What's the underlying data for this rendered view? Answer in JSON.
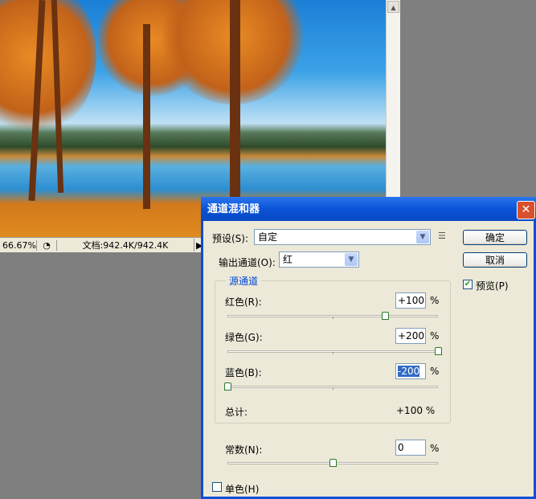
{
  "document": {
    "zoom": "66.67%",
    "doc_info": "文档:942.4K/942.4K"
  },
  "dialog": {
    "title": "通道混和器",
    "preset_label": "预设(S):",
    "preset_value": "自定",
    "output_label": "输出通道(O):",
    "output_value": "红",
    "ok": "确定",
    "cancel": "取消",
    "preview_label": "预览(P)",
    "preview_checked": true,
    "group_title": "源通道",
    "channels": [
      {
        "label": "红色(R):",
        "value": "+100",
        "percent": 100
      },
      {
        "label": "绿色(G):",
        "value": "+200",
        "percent": 200
      },
      {
        "label": "蓝色(B):",
        "value": "-200",
        "percent": -200
      }
    ],
    "unit": "%",
    "total_label": "总计:",
    "total_value": "+100 %",
    "constant_label": "常数(N):",
    "constant_value": "0",
    "constant_percent": 0,
    "mono_label": "单色(H)",
    "mono_checked": false
  }
}
